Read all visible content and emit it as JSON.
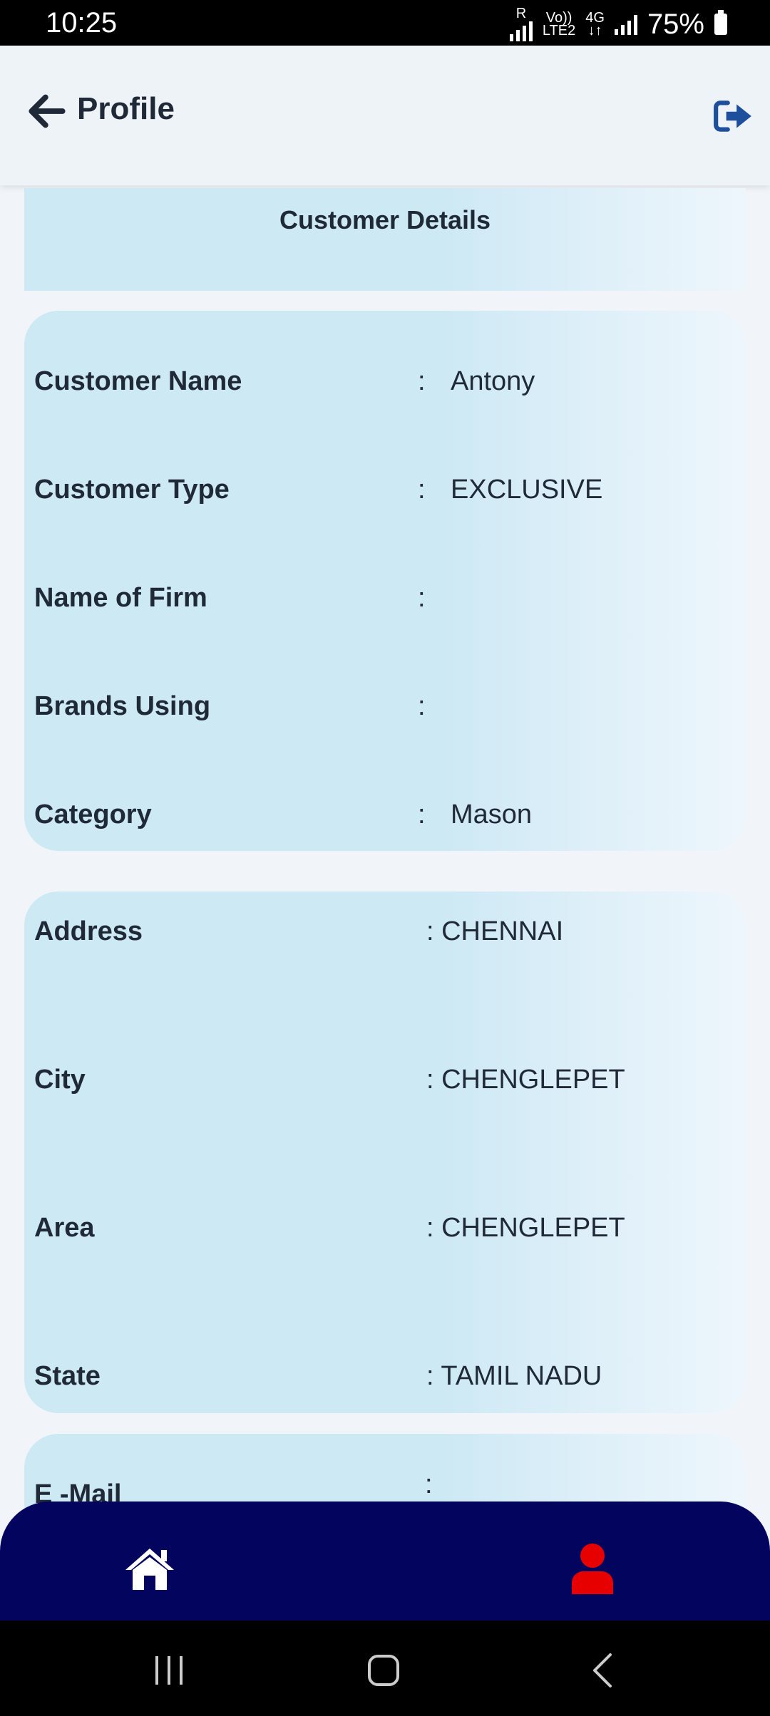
{
  "status_bar": {
    "time": "10:25",
    "sim": "R",
    "volte": "Vo))",
    "lte": "LTE2",
    "network": "4G",
    "battery": "75%"
  },
  "app_bar": {
    "title": "Profile"
  },
  "header": {
    "title": "Customer Details"
  },
  "details": [
    {
      "label": "Customer Name",
      "value": "Antony"
    },
    {
      "label": "Customer Type",
      "value": "EXCLUSIVE"
    },
    {
      "label": "Name of Firm",
      "value": ""
    },
    {
      "label": "Brands Using",
      "value": ""
    },
    {
      "label": "Category",
      "value": "Mason"
    }
  ],
  "address": [
    {
      "label": "Address",
      "value": ": CHENNAI"
    },
    {
      "label": "City",
      "value": ": CHENGLEPET"
    },
    {
      "label": "Area",
      "value": ": CHENGLEPET"
    },
    {
      "label": "State",
      "value": ": TAMIL NADU"
    }
  ],
  "contact": [
    {
      "label": "E -Mail",
      "value": ":"
    }
  ],
  "separator": ":",
  "colors": {
    "nav_bg": "#03045e",
    "card_bg": "#cde9f4",
    "active_icon": "#e60000",
    "logout_icon": "#1e4f9c"
  },
  "icons": {
    "back": "arrow-left-icon",
    "logout": "logout-icon",
    "home": "home-icon",
    "profile": "person-icon"
  }
}
